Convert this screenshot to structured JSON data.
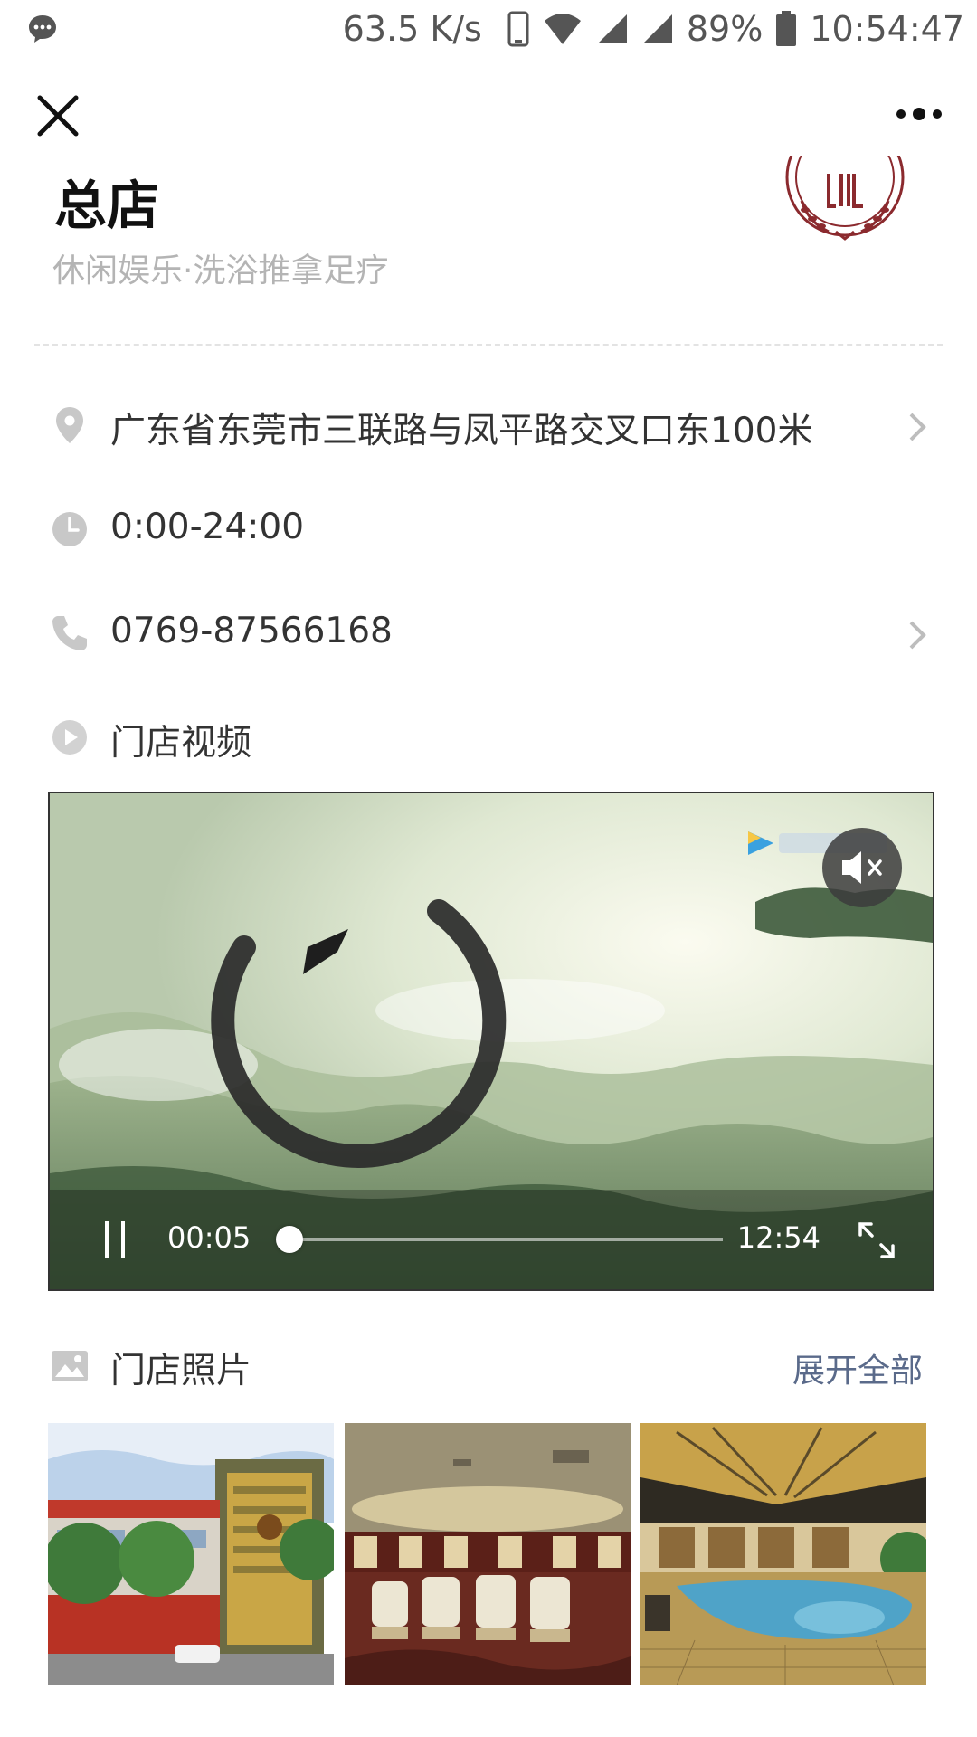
{
  "status_bar": {
    "speed": "63.5 K/s",
    "battery": "89%",
    "time": "10:54:47"
  },
  "header": {
    "title": "总店",
    "category": "休闲娱乐·洗浴推拿足疗"
  },
  "info": {
    "address": "广东省东莞市三联路与凤平路交叉口东100米",
    "hours": "0:00-24:00",
    "phone": "0769-87566168",
    "video_label": "门店视频"
  },
  "video": {
    "current_time": "00:05",
    "total_time": "12:54",
    "progress_fraction": 0.006,
    "muted": true
  },
  "photos": {
    "label": "门店照片",
    "expand_label": "展开全部"
  },
  "icons": {
    "close": "close-icon",
    "more": "more-icon",
    "location": "location-pin-icon",
    "clock": "clock-icon",
    "phone": "phone-icon",
    "play": "play-icon",
    "image": "image-icon",
    "mute": "mute-icon",
    "pause": "pause-icon",
    "fullscreen": "fullscreen-icon"
  },
  "colors": {
    "accent_link": "#5a6a8a",
    "secondary_text": "#b4b4b4",
    "icon_gray": "#c8c8c8",
    "logo_red": "#8b2a2e"
  }
}
